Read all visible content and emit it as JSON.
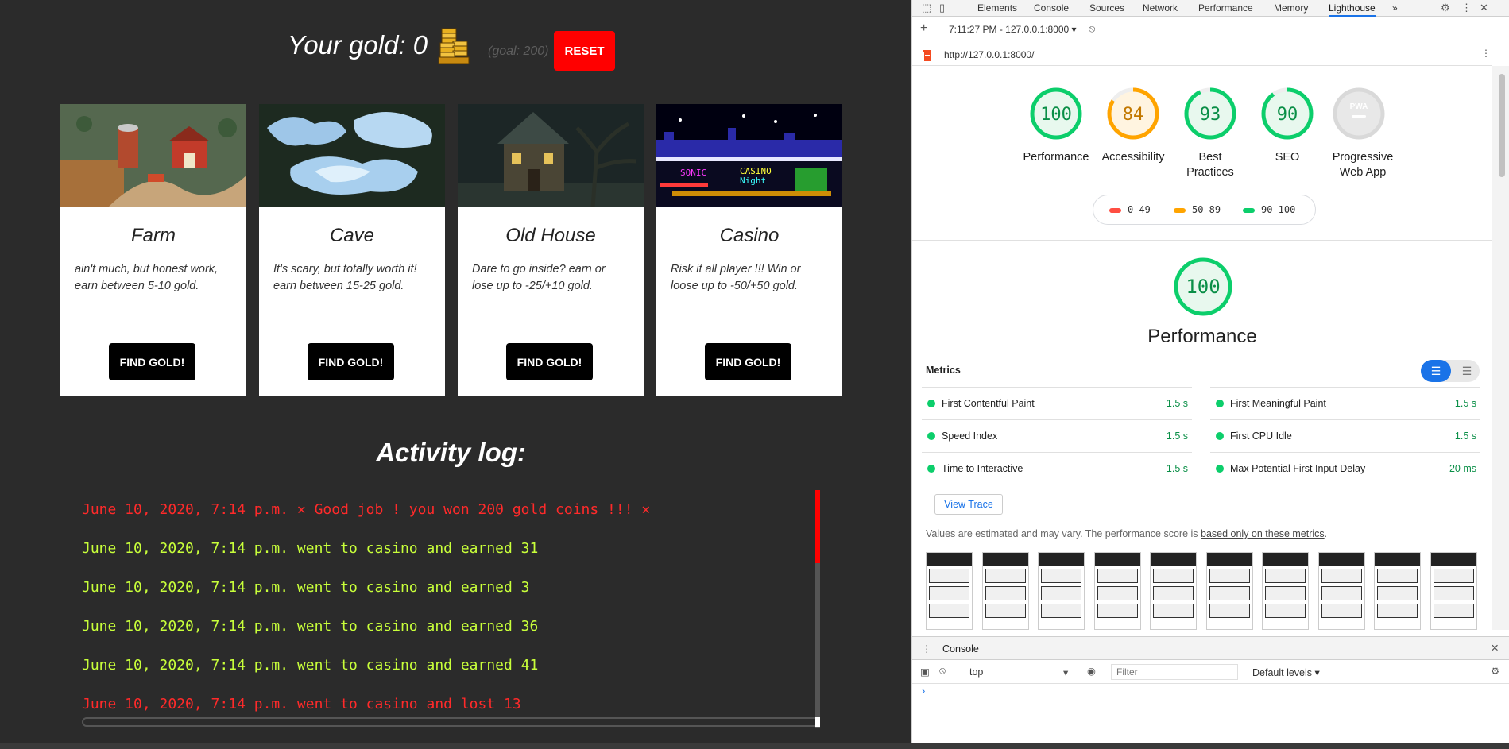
{
  "game": {
    "gold_label": "Your gold: 0",
    "goal_label": "(goal: 200)",
    "reset_label": "RESET",
    "cards": [
      {
        "title": "Farm",
        "desc": "ain't much, but honest work, earn between 5-10 gold.",
        "button": "FIND GOLD!"
      },
      {
        "title": "Cave",
        "desc": "It's scary, but totally worth it! earn between 15-25 gold.",
        "button": "FIND GOLD!"
      },
      {
        "title": "Old House",
        "desc": "Dare to go inside? earn or lose up to -25/+10 gold.",
        "button": "FIND GOLD!"
      },
      {
        "title": "Casino",
        "desc": "Risk it all player !!! Win or loose up to -50/+50 gold.",
        "button": "FIND GOLD!"
      }
    ],
    "activity_title": "Activity log:",
    "log": [
      "June 10, 2020, 7:14 p.m. ✕ Good job ! you won 200 gold coins !!! ✕",
      "June 10, 2020, 7:14 p.m. went to casino and earned 31",
      "June 10, 2020, 7:14 p.m. went to casino and earned 3",
      "June 10, 2020, 7:14 p.m. went to casino and earned 36",
      "June 10, 2020, 7:14 p.m. went to casino and earned 41",
      "June 10, 2020, 7:14 p.m. went to casino and lost 13"
    ]
  },
  "devtools": {
    "tabs": [
      "Elements",
      "Console",
      "Sources",
      "Network",
      "Performance",
      "Memory",
      "Lighthouse"
    ],
    "overflow": "»",
    "report_select": "7:11:27 PM - 127.0.0.1:8000",
    "url": "http://127.0.0.1:8000/",
    "scores": [
      {
        "label": "Performance",
        "value": "100",
        "score": 100
      },
      {
        "label": "Accessibility",
        "value": "84",
        "score": 84
      },
      {
        "label": "Best Practices",
        "value": "93",
        "score": 93
      },
      {
        "label": "SEO",
        "value": "90",
        "score": 90
      },
      {
        "label": "Progressive Web App",
        "value": "PWA",
        "score": 0
      }
    ],
    "legend": [
      "0–49",
      "50–89",
      "90–100"
    ],
    "perf_score": "100",
    "perf_title": "Performance",
    "metrics_title": "Metrics",
    "metrics": [
      {
        "name": "First Contentful Paint",
        "value": "1.5 s"
      },
      {
        "name": "First Meaningful Paint",
        "value": "1.5 s"
      },
      {
        "name": "Speed Index",
        "value": "1.5 s"
      },
      {
        "name": "First CPU Idle",
        "value": "1.5 s"
      },
      {
        "name": "Time to Interactive",
        "value": "1.5 s"
      },
      {
        "name": "Max Potential First Input Delay",
        "value": "20 ms"
      }
    ],
    "view_trace": "View Trace",
    "note_prefix": "Values are estimated and may vary. The performance score is ",
    "note_link": "based only on these metrics",
    "note_suffix": ".",
    "drawer_tab": "Console",
    "context": "top",
    "filter_placeholder": "Filter",
    "levels": "Default levels ▾",
    "prompt": "›"
  },
  "colors": {
    "reset": "#ff0000",
    "pass": "#0cce6b",
    "average": "#ffa400",
    "fail": "#ff4e42",
    "log_red": "#ff2a2a",
    "log_green": "#c8ff3a"
  }
}
